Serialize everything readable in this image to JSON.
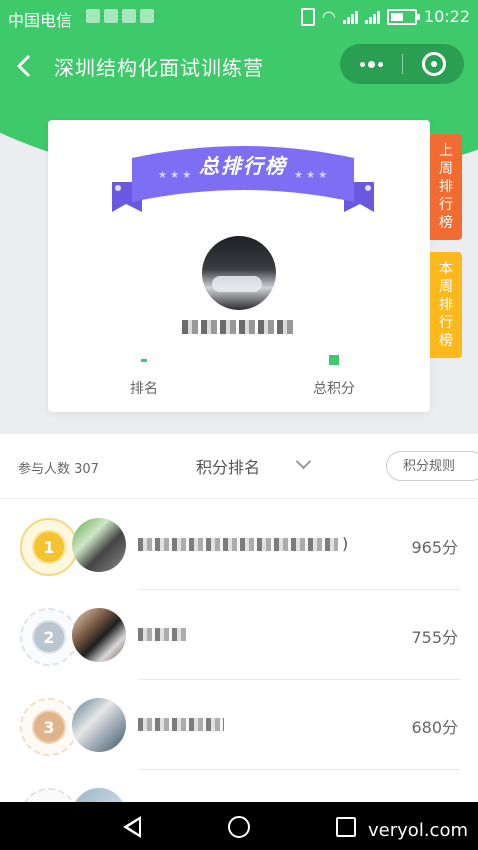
{
  "status_bar": {
    "carrier": "中国电信",
    "time": "10:22"
  },
  "header": {
    "title": "深圳结构化面试训练营",
    "back_icon": "chevron-left-icon"
  },
  "card": {
    "banner_text": "总排行榜",
    "stats": [
      {
        "label": "排名"
      },
      {
        "label": "总积分"
      }
    ]
  },
  "side_tabs": {
    "last_week": "上周排行榜",
    "this_week": "本周排行榜"
  },
  "filter": {
    "participants": "参与人数 307",
    "sort_label": "积分排名",
    "rules_button": "积分规则"
  },
  "ranking": [
    {
      "rank": "1",
      "score": "965分",
      "name_suffix": ")"
    },
    {
      "rank": "2",
      "score": "755分"
    },
    {
      "rank": "3",
      "score": "680分"
    }
  ],
  "watermark": "veryol.com",
  "colors": {
    "primary_green": "#3ec96a",
    "tab_last_week": "#f26b30",
    "tab_this_week": "#fdb81e",
    "banner_purple": "#7d6ef3"
  }
}
